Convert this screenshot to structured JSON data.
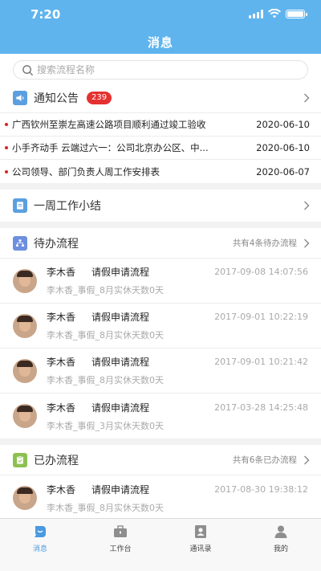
{
  "status": {
    "time": "7:20"
  },
  "header": {
    "title": "消息"
  },
  "search": {
    "placeholder": "搜索流程名称"
  },
  "notice": {
    "title": "通知公告",
    "badge": "239",
    "items": [
      {
        "text": "广西钦州至崇左高速公路项目顺利通过竣工验收",
        "date": "2020-06-10"
      },
      {
        "text": "小手齐动手 云端过六一：公司北京办公区、中...",
        "date": "2020-06-10"
      },
      {
        "text": "公司领导、部门负责人周工作安排表",
        "date": "2020-06-07"
      }
    ]
  },
  "weekly": {
    "title": "一周工作小结"
  },
  "todo": {
    "title": "待办流程",
    "count": "共有4条待办流程",
    "items": [
      {
        "name": "李木香",
        "type": "请假申请流程",
        "time": "2017-09-08 14:07:56",
        "desc": "李木香_事假_8月实休天数0天"
      },
      {
        "name": "李木香",
        "type": "请假申请流程",
        "time": "2017-09-01 10:22:19",
        "desc": "李木香_事假_8月实休天数0天"
      },
      {
        "name": "李木香",
        "type": "请假申请流程",
        "time": "2017-09-01 10:21:42",
        "desc": "李木香_事假_8月实休天数0天"
      },
      {
        "name": "李木香",
        "type": "请假申请流程",
        "time": "2017-03-28 14:25:48",
        "desc": "李木香_事假_3月实休天数0天"
      }
    ]
  },
  "done": {
    "title": "已办流程",
    "count": "共有6条已办流程",
    "items": [
      {
        "name": "李木香",
        "type": "请假申请流程",
        "time": "2017-08-30 19:38:12",
        "desc": "李木香_事假_8月实休天数0天"
      }
    ]
  },
  "tabs": [
    {
      "label": "消息",
      "icon": "message-icon",
      "active": true
    },
    {
      "label": "工作台",
      "icon": "briefcase-icon",
      "active": false
    },
    {
      "label": "通讯录",
      "icon": "contacts-icon",
      "active": false
    },
    {
      "label": "我的",
      "icon": "profile-icon",
      "active": false
    }
  ],
  "colors": {
    "header": "#5fb4ee",
    "accent": "#4a9ae0",
    "badge": "#e53030"
  }
}
